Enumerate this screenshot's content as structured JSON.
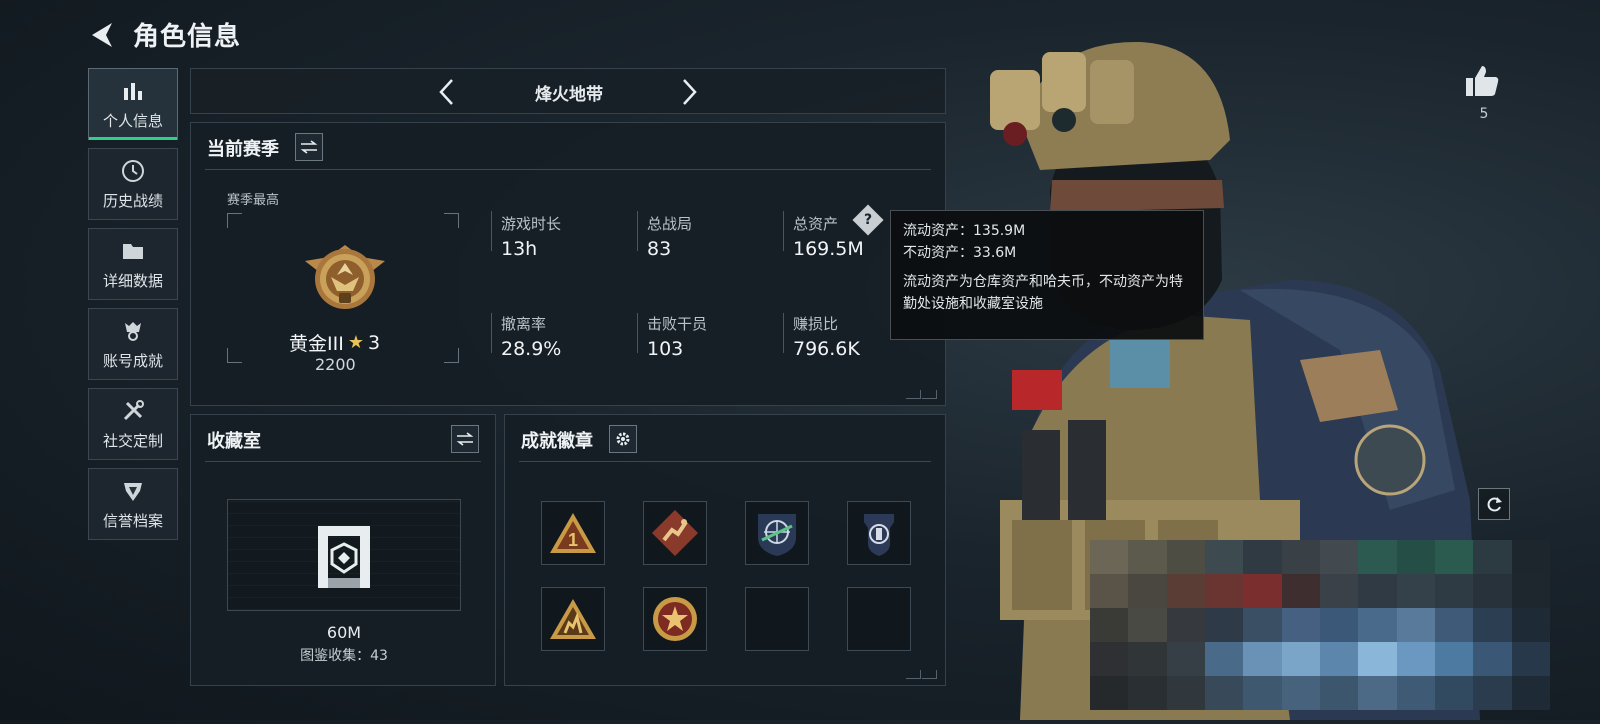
{
  "header": {
    "title": "角色信息"
  },
  "nav": [
    {
      "label": "个人信息",
      "icon": "bar-chart-icon",
      "active": true
    },
    {
      "label": "历史战绩",
      "icon": "clock-icon"
    },
    {
      "label": "详细数据",
      "icon": "folder-icon"
    },
    {
      "label": "账号成就",
      "icon": "trophy-icon"
    },
    {
      "label": "社交定制",
      "icon": "tools-icon"
    },
    {
      "label": "信誉档案",
      "icon": "shield-icon"
    }
  ],
  "mode_selector": {
    "label": "烽火地带"
  },
  "season": {
    "title": "当前赛季",
    "best_label": "赛季最高",
    "rank_name": "黄金III",
    "rank_stars": "3",
    "rank_score": "2200",
    "stats": [
      {
        "label": "游戏时长",
        "value": "13h"
      },
      {
        "label": "总战局",
        "value": "83"
      },
      {
        "label": "总资产",
        "value": "169.5M"
      },
      {
        "label": "撤离率",
        "value": "28.9%"
      },
      {
        "label": "击败干员",
        "value": "103"
      },
      {
        "label": "赚损比",
        "value": "796.6K"
      }
    ]
  },
  "tooltip": {
    "liquid": "流动资产：135.9M",
    "fixed": "不动资产：33.6M",
    "description": "流动资产为仓库资产和哈夫币，不动资产为特勤处设施和收藏室设施"
  },
  "collection": {
    "title": "收藏室",
    "value": "60M",
    "count_text": "图鉴收集：43"
  },
  "achievements": {
    "title": "成就徽章",
    "badges": [
      "rank-one-badge",
      "runner-badge",
      "globe-badge",
      "police-badge",
      "squad-badge",
      "star-medal-badge",
      "empty",
      "empty"
    ]
  },
  "likes": {
    "count": "5"
  },
  "colors": {
    "accent": "#2fd18a",
    "gold": "#c9a15a",
    "panel": "#161e25"
  }
}
